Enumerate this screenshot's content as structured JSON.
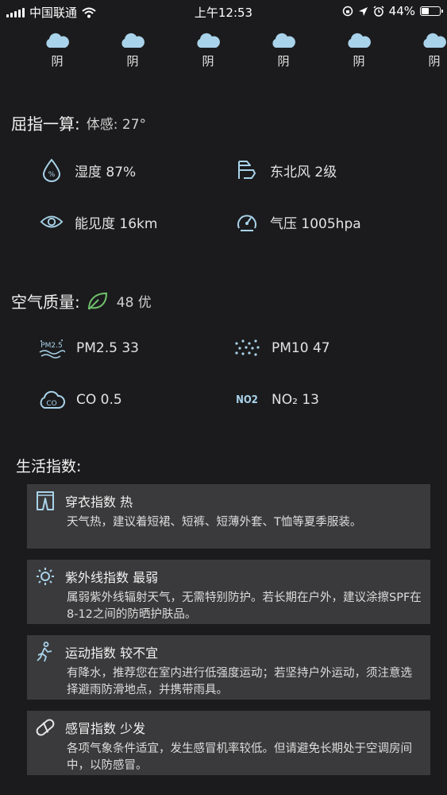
{
  "status_bar": {
    "carrier": "中国联通",
    "time": "上午12:53",
    "battery": "44%",
    "battery_level": 0.44
  },
  "forecast": [
    {
      "condition": "阴",
      "icon": "cloud-icon"
    },
    {
      "condition": "阴",
      "icon": "cloud-icon"
    },
    {
      "condition": "阴",
      "icon": "cloud-icon"
    },
    {
      "condition": "阴",
      "icon": "cloud-icon"
    },
    {
      "condition": "阴",
      "icon": "cloud-icon"
    },
    {
      "condition": "阴",
      "icon": "cloud-icon"
    }
  ],
  "details": {
    "title": "屈指一算:",
    "feels_like": "体感: 27°",
    "humidity": "湿度 87%",
    "wind": "东北风 2级",
    "visibility": "能见度 16km",
    "pressure": "气压 1005hpa"
  },
  "air": {
    "title": "空气质量:",
    "summary": "48  优",
    "accent": "#6fc26b",
    "pm25": "PM2.5  33",
    "pm10": "PM10  47",
    "co": "CO  0.5",
    "no2_icon_text": "NO2",
    "no2": "NO₂  13"
  },
  "life": {
    "title": "生活指数:",
    "cards": [
      {
        "icon": "clothing-icon",
        "title": "穿衣指数  热",
        "desc": "天气热，建议着短裙、短裤、短薄外套、T恤等夏季服装。"
      },
      {
        "icon": "sun-uv-icon",
        "title": "紫外线指数  最弱",
        "desc": "属弱紫外线辐射天气，无需特别防护。若长期在户外，建议涂擦SPF在8-12之间的防晒护肤品。"
      },
      {
        "icon": "running-icon",
        "title": "运动指数  较不宜",
        "desc": "有降水，推荐您在室内进行低强度运动；若坚持户外运动，须注意选择避雨防滑地点，并携带雨具。"
      },
      {
        "icon": "pill-icon",
        "title": "感冒指数  少发",
        "desc": "各项气象条件适宜，发生感冒机率较低。但请避免长期处于空调房间中，以防感冒。"
      }
    ]
  },
  "colors": {
    "background": "#1b1b1d",
    "card": "#3a3a3c",
    "icon_blue": "#a9d3ea"
  }
}
